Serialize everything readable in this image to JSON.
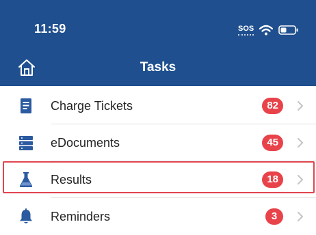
{
  "status_bar": {
    "time": "11:59",
    "carrier": "SOS"
  },
  "nav": {
    "title": "Tasks",
    "home_icon": "home-icon"
  },
  "colors": {
    "header": "#1f4f8f",
    "icon": "#2c5aa0",
    "badge": "#e8434a",
    "highlight": "#e0454f"
  },
  "tasks": [
    {
      "label": "Charge Tickets",
      "count": "82",
      "icon": "ticket-icon"
    },
    {
      "label": "eDocuments",
      "count": "45",
      "icon": "server-icon"
    },
    {
      "label": "Results",
      "count": "18",
      "icon": "flask-icon"
    },
    {
      "label": "Reminders",
      "count": "3",
      "icon": "bell-icon"
    }
  ]
}
